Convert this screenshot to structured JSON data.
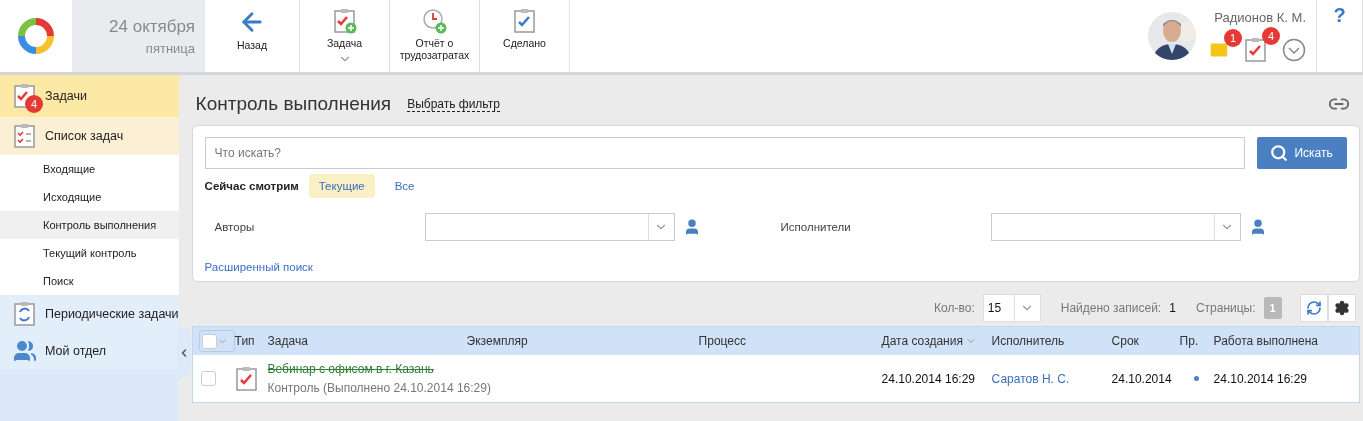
{
  "header": {
    "date": "24 октября",
    "weekday": "пятница",
    "toolbar": [
      {
        "kind": "back",
        "label": "Назад",
        "dropdown": false
      },
      {
        "kind": "task",
        "label": "Задача",
        "dropdown": true
      },
      {
        "kind": "report",
        "label": "Отчёт о трудозатратах",
        "dropdown": false
      },
      {
        "kind": "done",
        "label": "Сделано",
        "dropdown": false
      }
    ],
    "user": {
      "name": "Радионов К. М.",
      "mail_count": "1",
      "task_count": "4"
    },
    "help": "?"
  },
  "sidebar": {
    "items": [
      {
        "kind": "tasks",
        "label": "Задачи",
        "badge": "4",
        "selected": true
      },
      {
        "kind": "list",
        "label": "Список задач",
        "selected": false,
        "children": [
          {
            "label": "Входящие",
            "selected": false
          },
          {
            "label": "Исходящие",
            "selected": false
          },
          {
            "label": "Контроль выполнения",
            "selected": true
          },
          {
            "label": "Текущий контроль",
            "selected": false
          },
          {
            "label": "Поиск",
            "selected": false
          }
        ]
      },
      {
        "kind": "periodic",
        "label": "Периодические задачи",
        "selected": false
      },
      {
        "kind": "department",
        "label": "Мой отдел",
        "selected": false
      }
    ]
  },
  "page": {
    "title": "Контроль выполнения",
    "filter_link": "Выбрать фильтр"
  },
  "filter": {
    "search": {
      "placeholder": "Что искать?"
    },
    "search_button": "Искать",
    "view_label": "Сейчас смотрим",
    "views": [
      {
        "label": "Текущие",
        "selected": true
      },
      {
        "label": "Все",
        "selected": false
      }
    ],
    "fields": [
      {
        "label": "Авторы"
      },
      {
        "label": "Исполнители"
      }
    ],
    "advanced_link": "Расширенный поиск"
  },
  "pager": {
    "count_label": "Кол-во:",
    "count": "15",
    "found_label": "Найдено записей:",
    "found": "1",
    "pages_label": "Страницы:",
    "pages": [
      {
        "label": "1",
        "selected": true
      }
    ]
  },
  "table": {
    "all_checked": false,
    "columns": [
      {
        "label": "Тип",
        "sorted": false
      },
      {
        "label": "Задача",
        "sorted": false
      },
      {
        "label": "Экземпляр",
        "sorted": false
      },
      {
        "label": "Процесс",
        "sorted": false
      },
      {
        "label": "Дата создания",
        "sorted": true
      },
      {
        "label": "Исполнитель",
        "sorted": false
      },
      {
        "label": "Срок",
        "sorted": false
      },
      {
        "label": "Пр.",
        "sorted": false
      },
      {
        "label": "Работа выполнена",
        "sorted": false
      }
    ],
    "rows": [
      {
        "checked": false,
        "task": "Вебинар с офисом в г. Казань",
        "done": true,
        "status": "Контроль (Выполнено 24.10.2014 16:29)",
        "created": "24.10.2014 16:29",
        "executor": "Саратов Н. С.",
        "deadline": "24.10.2014",
        "priority_dot": true,
        "completed": "24.10.2014 16:29"
      }
    ]
  }
}
